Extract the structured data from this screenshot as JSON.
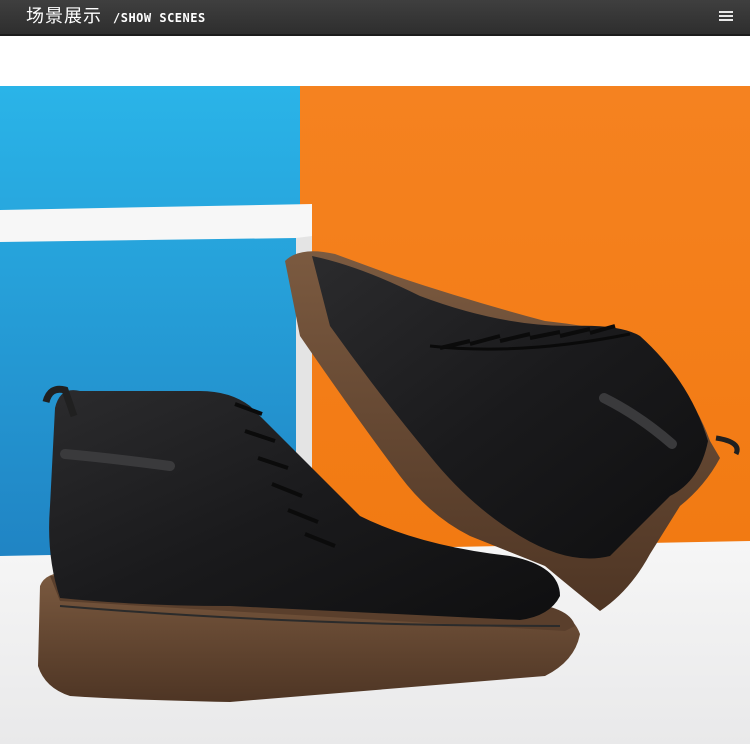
{
  "header": {
    "title_cn": "场景展示",
    "title_en": "/SHOW SCENES",
    "menu_icon": "menu-icon",
    "background_color": "#353535"
  },
  "scene": {
    "colors": {
      "cyan_wall": "#2a9fd6",
      "orange_wall": "#f5821f",
      "floor": "#f3f3f3",
      "sole": "#6b4a33",
      "leather": "#1d1d1f"
    }
  }
}
